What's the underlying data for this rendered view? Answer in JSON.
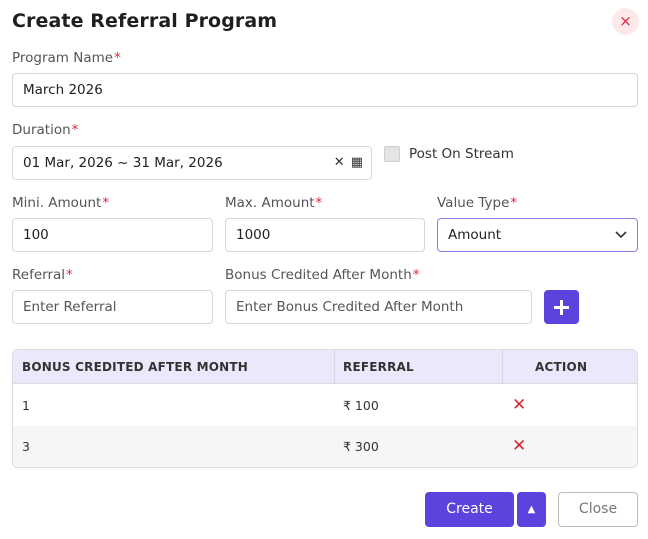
{
  "dialog": {
    "title": "Create Referral Program",
    "close_icon": "×"
  },
  "form": {
    "program_name": {
      "label": "Program Name",
      "required": "*",
      "value": "March 2026"
    },
    "duration": {
      "label": "Duration",
      "required": "*",
      "value": "01 Mar, 2026 ~ 31 Mar, 2026",
      "clear_icon": "✕",
      "calendar_icon": "▦"
    },
    "post_on_stream": {
      "label": "Post On Stream",
      "checked": false
    },
    "min_amount": {
      "label": "Mini. Amount",
      "required": "*",
      "value": "100"
    },
    "max_amount": {
      "label": "Max. Amount",
      "required": "*",
      "value": "1000"
    },
    "value_type": {
      "label": "Value Type",
      "required": "*",
      "value": "Amount",
      "chevron_icon": "⌄"
    },
    "referral": {
      "label": "Referral",
      "required": "*",
      "placeholder": "Enter Referral"
    },
    "bonus_month": {
      "label": "Bonus Credited After Month",
      "required": "*",
      "placeholder": "Enter Bonus Credited After Month"
    }
  },
  "table": {
    "headers": [
      "BONUS CREDITED AFTER MONTH",
      "REFERRAL",
      "ACTION"
    ],
    "rows": [
      {
        "month": "1",
        "referral": "₹ 100",
        "action_icon": "✕"
      },
      {
        "month": "3",
        "referral": "₹ 300",
        "action_icon": "✕"
      }
    ]
  },
  "footer": {
    "create_label": "Create",
    "caret_icon": "▲",
    "close_label": "Close"
  },
  "colors": {
    "primary": "#5b43dd",
    "danger": "#d9283a",
    "table_header_bg": "#ebe8fb"
  }
}
